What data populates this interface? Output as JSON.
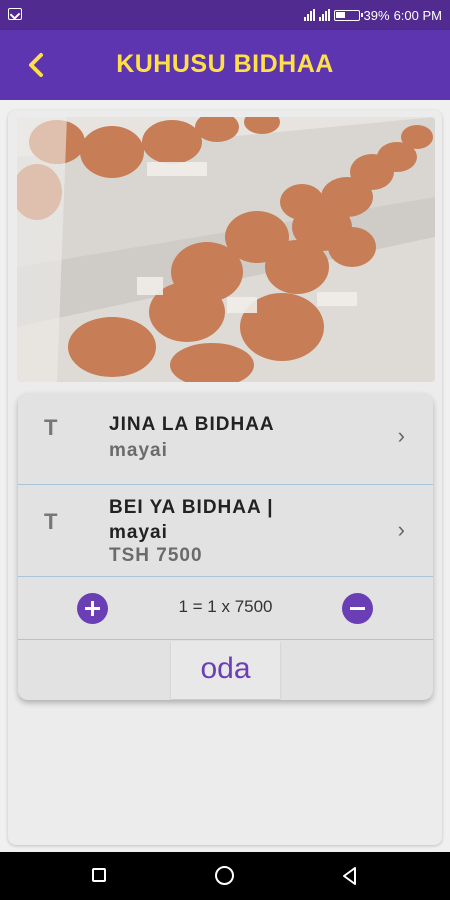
{
  "status_bar": {
    "battery": "39%",
    "time": "6:00 PM"
  },
  "app_bar": {
    "title": "KUHUSU BIDHAA",
    "back_icon": "chevron-left-icon"
  },
  "product": {
    "image_alt_icon": "eggs-photo",
    "rows": [
      {
        "icon": "T",
        "label": "JINA LA BIDHAA",
        "value": "mayai"
      },
      {
        "icon": "T",
        "label": "BEI YA BIDHAA  |  mayai",
        "value": "TSH 7500"
      }
    ],
    "quantity_text": "1 = 1 x  7500",
    "order_button": "oda"
  },
  "colors": {
    "primary": "#5e35b1",
    "title": "#fde047",
    "accent_button": "#6a3fb5"
  }
}
